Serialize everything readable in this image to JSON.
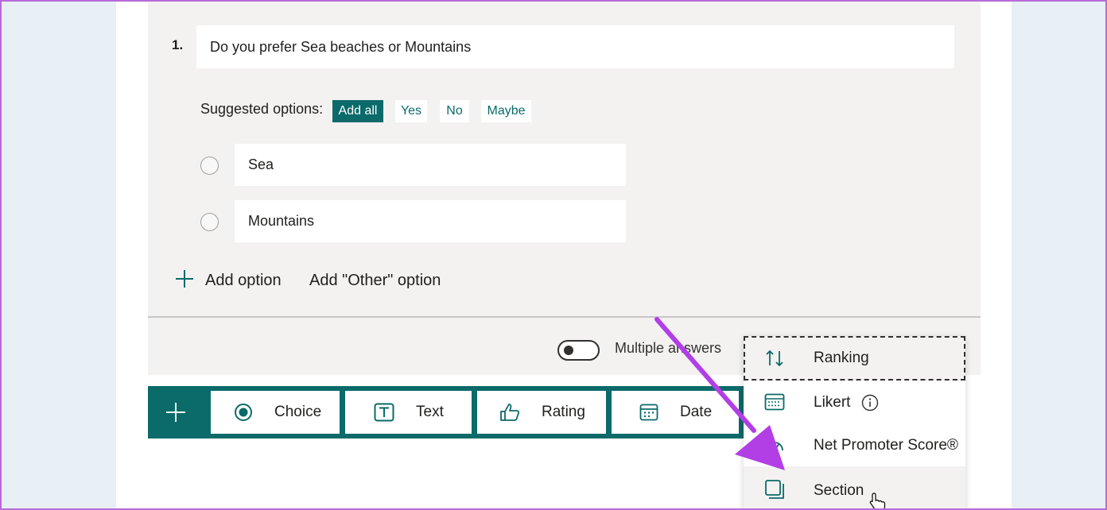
{
  "question": {
    "number": "1.",
    "title": "Do you prefer Sea beaches or Mountains"
  },
  "suggested": {
    "label": "Suggested options:",
    "add_all": "Add all",
    "chips": [
      "Yes",
      "No",
      "Maybe"
    ]
  },
  "options": [
    "Sea",
    "Mountains"
  ],
  "add_option": "Add option",
  "add_other_option": "Add \"Other\" option",
  "multiple_answers": "Multiple answers",
  "toolbar": {
    "choice": "Choice",
    "text": "Text",
    "rating": "Rating",
    "date": "Date"
  },
  "menu": {
    "items": [
      "Ranking",
      "Likert",
      "Net Promoter Score®",
      "Section"
    ]
  },
  "colors": {
    "accent": "#0b6a6a",
    "annotation_arrow": "#b23ee6"
  }
}
